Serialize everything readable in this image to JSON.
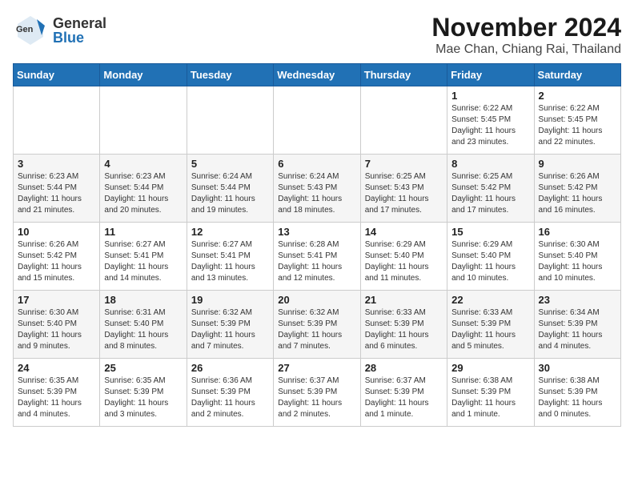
{
  "header": {
    "logo_general": "General",
    "logo_blue": "Blue",
    "month_title": "November 2024",
    "location": "Mae Chan, Chiang Rai, Thailand"
  },
  "days_of_week": [
    "Sunday",
    "Monday",
    "Tuesday",
    "Wednesday",
    "Thursday",
    "Friday",
    "Saturday"
  ],
  "weeks": [
    [
      {
        "day": "",
        "info": ""
      },
      {
        "day": "",
        "info": ""
      },
      {
        "day": "",
        "info": ""
      },
      {
        "day": "",
        "info": ""
      },
      {
        "day": "",
        "info": ""
      },
      {
        "day": "1",
        "info": "Sunrise: 6:22 AM\nSunset: 5:45 PM\nDaylight: 11 hours and 23 minutes."
      },
      {
        "day": "2",
        "info": "Sunrise: 6:22 AM\nSunset: 5:45 PM\nDaylight: 11 hours and 22 minutes."
      }
    ],
    [
      {
        "day": "3",
        "info": "Sunrise: 6:23 AM\nSunset: 5:44 PM\nDaylight: 11 hours and 21 minutes."
      },
      {
        "day": "4",
        "info": "Sunrise: 6:23 AM\nSunset: 5:44 PM\nDaylight: 11 hours and 20 minutes."
      },
      {
        "day": "5",
        "info": "Sunrise: 6:24 AM\nSunset: 5:44 PM\nDaylight: 11 hours and 19 minutes."
      },
      {
        "day": "6",
        "info": "Sunrise: 6:24 AM\nSunset: 5:43 PM\nDaylight: 11 hours and 18 minutes."
      },
      {
        "day": "7",
        "info": "Sunrise: 6:25 AM\nSunset: 5:43 PM\nDaylight: 11 hours and 17 minutes."
      },
      {
        "day": "8",
        "info": "Sunrise: 6:25 AM\nSunset: 5:42 PM\nDaylight: 11 hours and 17 minutes."
      },
      {
        "day": "9",
        "info": "Sunrise: 6:26 AM\nSunset: 5:42 PM\nDaylight: 11 hours and 16 minutes."
      }
    ],
    [
      {
        "day": "10",
        "info": "Sunrise: 6:26 AM\nSunset: 5:42 PM\nDaylight: 11 hours and 15 minutes."
      },
      {
        "day": "11",
        "info": "Sunrise: 6:27 AM\nSunset: 5:41 PM\nDaylight: 11 hours and 14 minutes."
      },
      {
        "day": "12",
        "info": "Sunrise: 6:27 AM\nSunset: 5:41 PM\nDaylight: 11 hours and 13 minutes."
      },
      {
        "day": "13",
        "info": "Sunrise: 6:28 AM\nSunset: 5:41 PM\nDaylight: 11 hours and 12 minutes."
      },
      {
        "day": "14",
        "info": "Sunrise: 6:29 AM\nSunset: 5:40 PM\nDaylight: 11 hours and 11 minutes."
      },
      {
        "day": "15",
        "info": "Sunrise: 6:29 AM\nSunset: 5:40 PM\nDaylight: 11 hours and 10 minutes."
      },
      {
        "day": "16",
        "info": "Sunrise: 6:30 AM\nSunset: 5:40 PM\nDaylight: 11 hours and 10 minutes."
      }
    ],
    [
      {
        "day": "17",
        "info": "Sunrise: 6:30 AM\nSunset: 5:40 PM\nDaylight: 11 hours and 9 minutes."
      },
      {
        "day": "18",
        "info": "Sunrise: 6:31 AM\nSunset: 5:40 PM\nDaylight: 11 hours and 8 minutes."
      },
      {
        "day": "19",
        "info": "Sunrise: 6:32 AM\nSunset: 5:39 PM\nDaylight: 11 hours and 7 minutes."
      },
      {
        "day": "20",
        "info": "Sunrise: 6:32 AM\nSunset: 5:39 PM\nDaylight: 11 hours and 7 minutes."
      },
      {
        "day": "21",
        "info": "Sunrise: 6:33 AM\nSunset: 5:39 PM\nDaylight: 11 hours and 6 minutes."
      },
      {
        "day": "22",
        "info": "Sunrise: 6:33 AM\nSunset: 5:39 PM\nDaylight: 11 hours and 5 minutes."
      },
      {
        "day": "23",
        "info": "Sunrise: 6:34 AM\nSunset: 5:39 PM\nDaylight: 11 hours and 4 minutes."
      }
    ],
    [
      {
        "day": "24",
        "info": "Sunrise: 6:35 AM\nSunset: 5:39 PM\nDaylight: 11 hours and 4 minutes."
      },
      {
        "day": "25",
        "info": "Sunrise: 6:35 AM\nSunset: 5:39 PM\nDaylight: 11 hours and 3 minutes."
      },
      {
        "day": "26",
        "info": "Sunrise: 6:36 AM\nSunset: 5:39 PM\nDaylight: 11 hours and 2 minutes."
      },
      {
        "day": "27",
        "info": "Sunrise: 6:37 AM\nSunset: 5:39 PM\nDaylight: 11 hours and 2 minutes."
      },
      {
        "day": "28",
        "info": "Sunrise: 6:37 AM\nSunset: 5:39 PM\nDaylight: 11 hours and 1 minute."
      },
      {
        "day": "29",
        "info": "Sunrise: 6:38 AM\nSunset: 5:39 PM\nDaylight: 11 hours and 1 minute."
      },
      {
        "day": "30",
        "info": "Sunrise: 6:38 AM\nSunset: 5:39 PM\nDaylight: 11 hours and 0 minutes."
      }
    ]
  ]
}
